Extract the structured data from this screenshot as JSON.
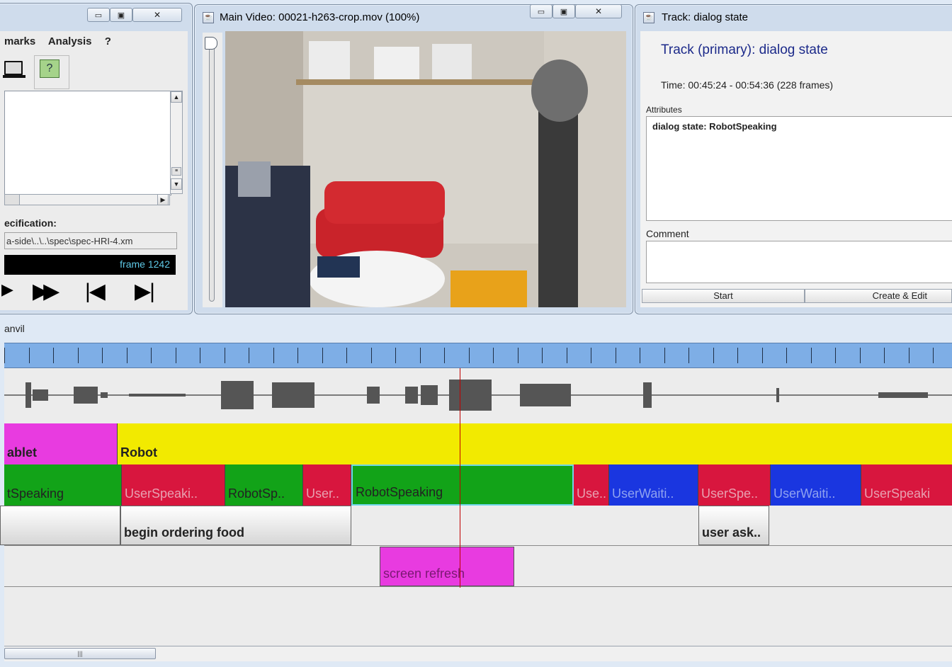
{
  "left_window": {
    "menu": [
      "marks",
      "Analysis",
      "?"
    ],
    "spec_label": "ecification:",
    "spec_path": "a-side\\..\\..\\spec\\spec-HRI-4.xm",
    "frame_label": "frame 1242",
    "transport": [
      "▶",
      "▶▶",
      "|◀",
      "▶|"
    ],
    "icons": [
      "monitor-icon",
      "help-icon"
    ]
  },
  "video_window": {
    "title": "Main Video: 00021-h263-crop.mov (100%)"
  },
  "track_window": {
    "title": "Track: dialog state",
    "heading": "Track (primary): dialog state",
    "time": "Time: 00:45:24 - 00:54:36 (228 frames)",
    "attributes_label": "Attributes",
    "attribute_value": "dialog state: RobotSpeaking",
    "comment_label": "Comment",
    "start_button": "Start",
    "create_button": "Create & Edit"
  },
  "anvil": {
    "title": "anvil",
    "colors": {
      "magenta": "#e83be0",
      "yellow": "#f2ea00",
      "green": "#12a318",
      "red": "#d8163e",
      "blue": "#1a36e0"
    },
    "track_focus": [
      {
        "label": "ablet",
        "color": "#e83be0"
      },
      {
        "label": "Robot",
        "color": "#f2ea00"
      }
    ],
    "track_dialog": [
      {
        "label": "tSpeaking",
        "color": "#12a318"
      },
      {
        "label": "UserSpeaki..",
        "color": "#d8163e"
      },
      {
        "label": "RobotSp..",
        "color": "#12a318"
      },
      {
        "label": "User..",
        "color": "#d8163e"
      },
      {
        "label": "RobotSpeaking",
        "color": "#12a318"
      },
      {
        "label": "Use..",
        "color": "#d8163e"
      },
      {
        "label": "UserWaiti..",
        "color": "#1a36e0"
      },
      {
        "label": "UserSpe..",
        "color": "#d8163e"
      },
      {
        "label": "UserWaiti..",
        "color": "#1a36e0"
      },
      {
        "label": "UserSpeaki",
        "color": "#d8163e"
      }
    ],
    "track_task": [
      {
        "label": "begin ordering food"
      },
      {
        "label": "user ask.."
      }
    ],
    "track_screen": [
      {
        "label": "screen refresh",
        "color": "#e83be0"
      }
    ]
  }
}
